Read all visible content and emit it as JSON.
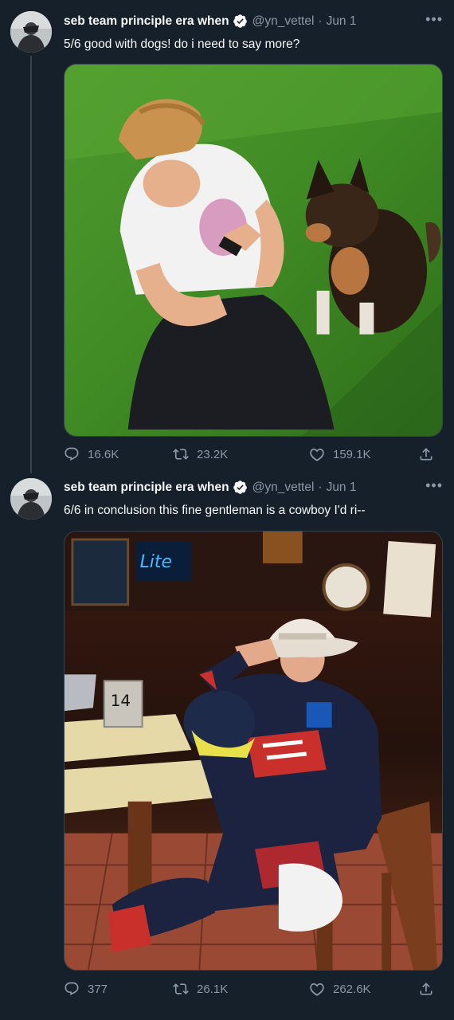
{
  "tweets": [
    {
      "author_name": "seb team principle era when",
      "handle": "@yn_vettel",
      "separator": "·",
      "date": "Jun 1",
      "text": "5/6 good with dogs! do i need to say more?",
      "replies": "16.6K",
      "retweets": "23.2K",
      "likes": "159.1K"
    },
    {
      "author_name": "seb team principle era when",
      "handle": "@yn_vettel",
      "separator": "·",
      "date": "Jun 1",
      "text": "6/6 in conclusion this fine gentleman is a cowboy I'd ri--",
      "replies": "377",
      "retweets": "26.1K",
      "likes": "262.6K"
    }
  ],
  "colors": {
    "background": "#15202b",
    "text_primary": "#f7f9f9",
    "text_secondary": "#8b98a5",
    "verified": "#1d9bf0",
    "border": "#38444d"
  },
  "icons": [
    "more-icon",
    "verified-icon",
    "reply-icon",
    "retweet-icon",
    "like-icon",
    "share-icon"
  ]
}
